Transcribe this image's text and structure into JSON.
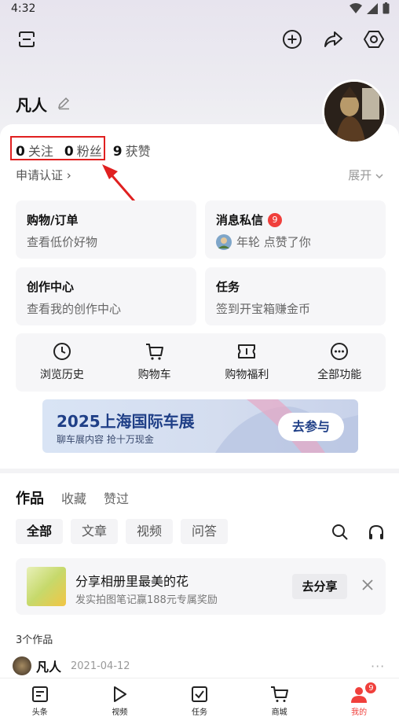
{
  "status": {
    "time": "4:32"
  },
  "profile": {
    "username": "凡人"
  },
  "stats": [
    {
      "value": "0",
      "label": "关注"
    },
    {
      "value": "0",
      "label": "粉丝"
    },
    {
      "value": "9",
      "label": "获赞"
    }
  ],
  "verify_label": "申请认证 ›",
  "expand_label": "展开",
  "tiles": {
    "orders": {
      "title": "购物/订单",
      "subtitle": "查看低价好物"
    },
    "messages": {
      "title": "消息私信",
      "badge": "9",
      "subtitle": "年轮 点赞了你"
    },
    "creator": {
      "title": "创作中心",
      "subtitle": "查看我的创作中心"
    },
    "tasks": {
      "title": "任务",
      "subtitle": "签到开宝箱赚金币"
    }
  },
  "shortcuts": [
    {
      "label": "浏览历史",
      "icon": "clock-icon"
    },
    {
      "label": "购物车",
      "icon": "cart-icon"
    },
    {
      "label": "购物福利",
      "icon": "ticket-icon"
    },
    {
      "label": "全部功能",
      "icon": "more-icon"
    }
  ],
  "banner": {
    "title": "2025上海国际车展",
    "subtitle": "聊车展内容  抢十万现金",
    "button": "去参与"
  },
  "content_tabs": [
    "作品",
    "收藏",
    "赞过"
  ],
  "filters": [
    "全部",
    "文章",
    "视频",
    "问答"
  ],
  "share_card": {
    "title": "分享相册里最美的花",
    "subtitle": "发实拍图笔记赢188元专属奖励",
    "button": "去分享"
  },
  "works_count": "3个作品",
  "post": {
    "author": "凡人",
    "date": "2021-04-12",
    "more": "···"
  },
  "bottom_nav": [
    {
      "label": "头条",
      "icon": "news-icon"
    },
    {
      "label": "视频",
      "icon": "play-icon"
    },
    {
      "label": "任务",
      "icon": "task-icon"
    },
    {
      "label": "商城",
      "icon": "cart-icon"
    },
    {
      "label": "我的",
      "icon": "user-icon",
      "badge": "9"
    }
  ],
  "colors": {
    "accent": "#f0403c",
    "highlight_box": "#e02020",
    "banner_text": "#1f3f87"
  }
}
